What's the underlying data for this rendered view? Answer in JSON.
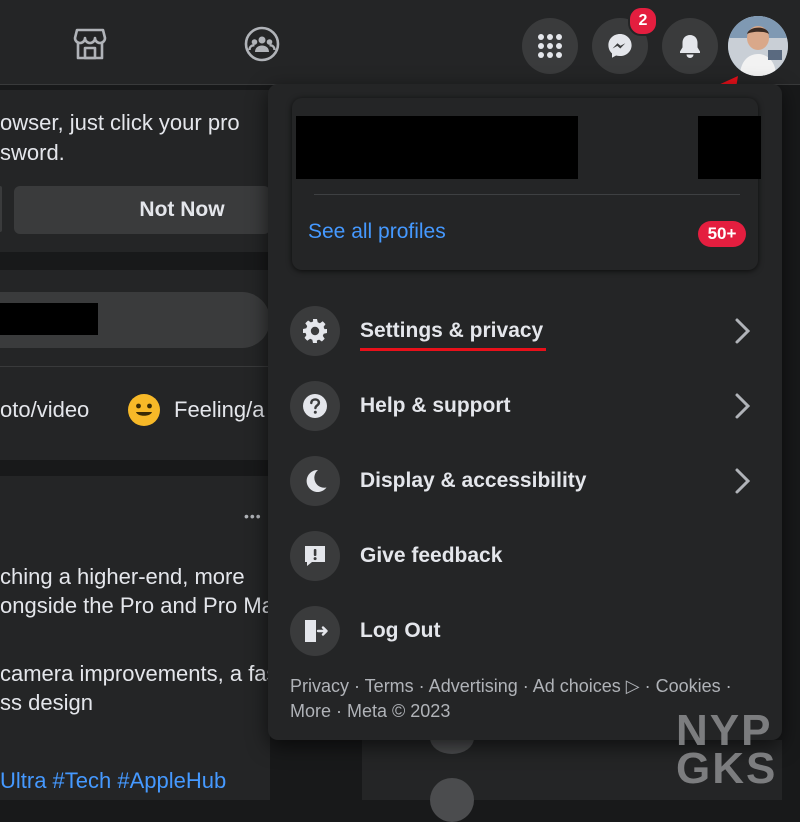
{
  "left": {
    "prompt_line1": "owser, just click your pro",
    "prompt_line2": "sword.",
    "not_now": "Not Now",
    "photo_video": "oto/video",
    "feeling": "Feeling/a",
    "more_dots": "•••",
    "post_line1": "ching a higher-end, more",
    "post_line2": "ongside the Pro and Pro Max",
    "post_line3": "camera improvements, a fas",
    "post_line4": "ss design",
    "hashtags": "Ultra #Tech #AppleHub"
  },
  "topbar": {
    "messenger_badge": "2"
  },
  "menu": {
    "see_all_profiles": "See all profiles",
    "profiles_badge": "50+",
    "items": [
      {
        "label": "Settings & privacy",
        "icon": "gear-icon"
      },
      {
        "label": "Help & support",
        "icon": "question-icon"
      },
      {
        "label": "Display & accessibility",
        "icon": "moon-icon"
      },
      {
        "label": "Give feedback",
        "icon": "feedback-icon"
      },
      {
        "label": "Log Out",
        "icon": "logout-icon"
      }
    ],
    "footer_line1": "Privacy · Terms · Advertising · Ad choices ▷ · Cookies ·",
    "footer_line2": "More · Meta © 2023"
  },
  "watermark": {
    "line1": "NYP",
    "line2": "GKS"
  },
  "colors": {
    "background": "#18191a",
    "surface": "#242526",
    "link": "#4599ff",
    "badge": "#e41e3f",
    "annotation": "#e8101a"
  }
}
